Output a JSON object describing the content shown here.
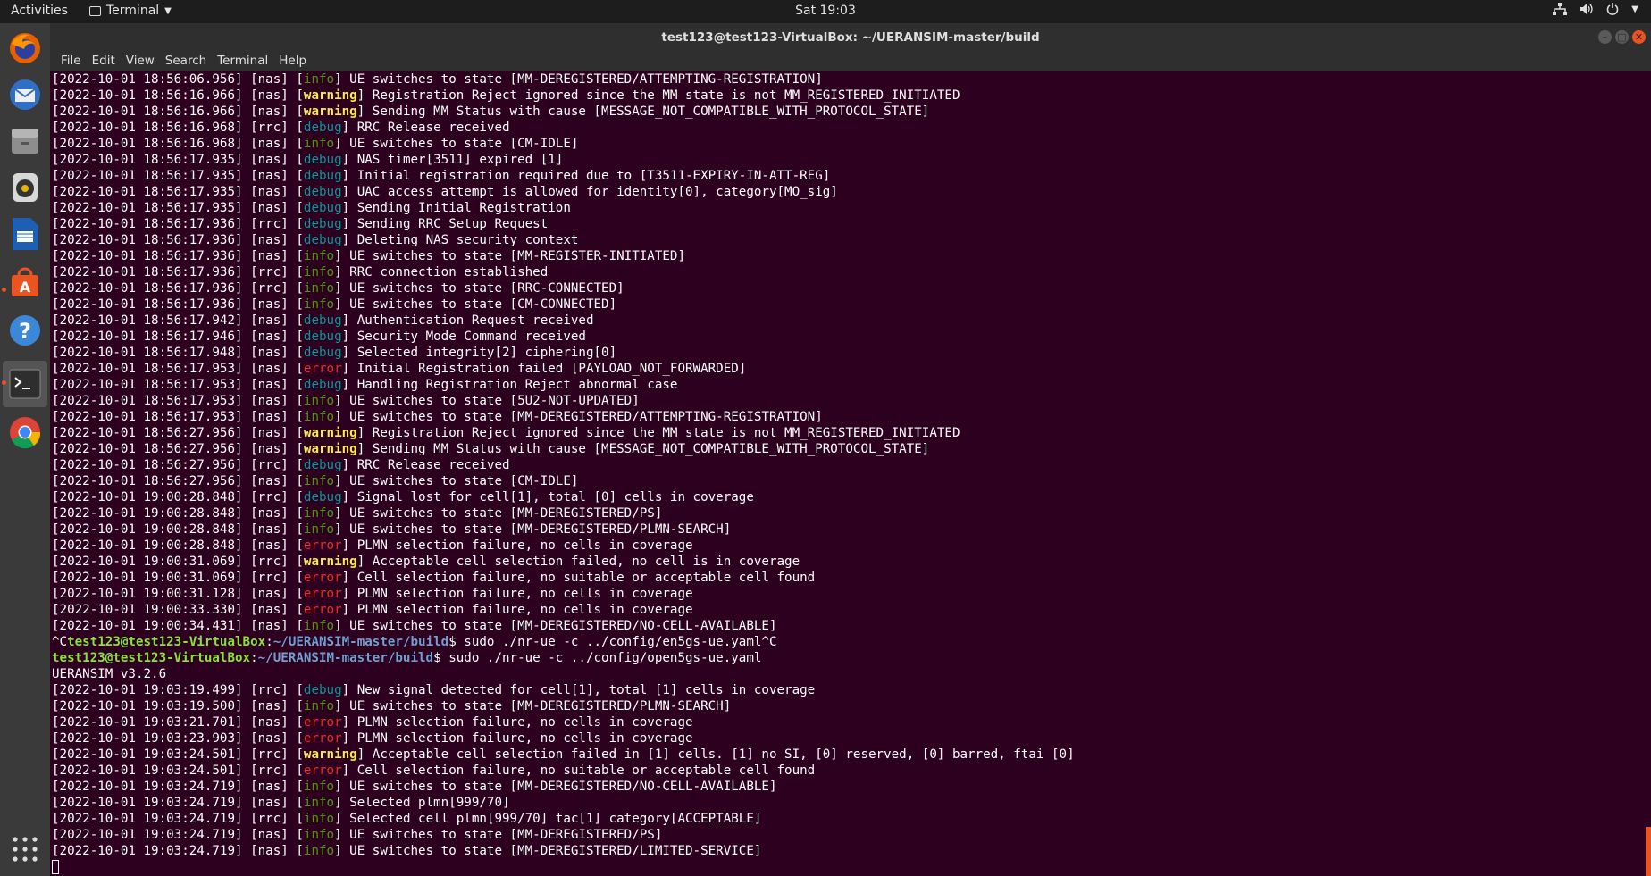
{
  "topbar": {
    "activities": "Activities",
    "app_name": "Terminal",
    "clock": "Sat 19:03"
  },
  "dock": {
    "items": [
      "firefox-icon",
      "thunderbird-icon",
      "files-icon",
      "rhythmbox-icon",
      "writer-icon",
      "software-center-icon",
      "help-icon",
      "terminal-icon",
      "chrome-icon"
    ],
    "apps_grid": "show-applications-icon"
  },
  "window": {
    "title": "test123@test123-VirtualBox: ~/UERANSIM-master/build",
    "menu": [
      "File",
      "Edit",
      "View",
      "Search",
      "Terminal",
      "Help"
    ]
  },
  "colors": {
    "info": "#4e9a06",
    "debug": "#06989a",
    "warning": "#fce94f",
    "error": "#ef2929",
    "background": "#2c001e",
    "accent": "#e95420"
  },
  "terminal": {
    "lines": [
      {
        "t": "log",
        "ts": "[2022-10-01 18:56:06.956]",
        "mod": "[nas]",
        "lvl": "info",
        "msg": " UE switches to state [MM-DEREGISTERED/ATTEMPTING-REGISTRATION]"
      },
      {
        "t": "log",
        "ts": "[2022-10-01 18:56:16.966]",
        "mod": "[nas]",
        "lvl": "warning",
        "msg": " Registration Reject ignored since the MM state is not MM_REGISTERED_INITIATED"
      },
      {
        "t": "log",
        "ts": "[2022-10-01 18:56:16.966]",
        "mod": "[nas]",
        "lvl": "warning",
        "msg": " Sending MM Status with cause [MESSAGE_NOT_COMPATIBLE_WITH_PROTOCOL_STATE]"
      },
      {
        "t": "log",
        "ts": "[2022-10-01 18:56:16.968]",
        "mod": "[rrc]",
        "lvl": "debug",
        "msg": " RRC Release received"
      },
      {
        "t": "log",
        "ts": "[2022-10-01 18:56:16.968]",
        "mod": "[nas]",
        "lvl": "info",
        "msg": " UE switches to state [CM-IDLE]"
      },
      {
        "t": "log",
        "ts": "[2022-10-01 18:56:17.935]",
        "mod": "[nas]",
        "lvl": "debug",
        "msg": " NAS timer[3511] expired [1]"
      },
      {
        "t": "log",
        "ts": "[2022-10-01 18:56:17.935]",
        "mod": "[nas]",
        "lvl": "debug",
        "msg": " Initial registration required due to [T3511-EXPIRY-IN-ATT-REG]"
      },
      {
        "t": "log",
        "ts": "[2022-10-01 18:56:17.935]",
        "mod": "[nas]",
        "lvl": "debug",
        "msg": " UAC access attempt is allowed for identity[0], category[MO_sig]"
      },
      {
        "t": "log",
        "ts": "[2022-10-01 18:56:17.935]",
        "mod": "[nas]",
        "lvl": "debug",
        "msg": " Sending Initial Registration"
      },
      {
        "t": "log",
        "ts": "[2022-10-01 18:56:17.936]",
        "mod": "[rrc]",
        "lvl": "debug",
        "msg": " Sending RRC Setup Request"
      },
      {
        "t": "log",
        "ts": "[2022-10-01 18:56:17.936]",
        "mod": "[nas]",
        "lvl": "debug",
        "msg": " Deleting NAS security context"
      },
      {
        "t": "log",
        "ts": "[2022-10-01 18:56:17.936]",
        "mod": "[nas]",
        "lvl": "info",
        "msg": " UE switches to state [MM-REGISTER-INITIATED]"
      },
      {
        "t": "log",
        "ts": "[2022-10-01 18:56:17.936]",
        "mod": "[rrc]",
        "lvl": "info",
        "msg": " RRC connection established"
      },
      {
        "t": "log",
        "ts": "[2022-10-01 18:56:17.936]",
        "mod": "[rrc]",
        "lvl": "info",
        "msg": " UE switches to state [RRC-CONNECTED]"
      },
      {
        "t": "log",
        "ts": "[2022-10-01 18:56:17.936]",
        "mod": "[nas]",
        "lvl": "info",
        "msg": " UE switches to state [CM-CONNECTED]"
      },
      {
        "t": "log",
        "ts": "[2022-10-01 18:56:17.942]",
        "mod": "[nas]",
        "lvl": "debug",
        "msg": " Authentication Request received"
      },
      {
        "t": "log",
        "ts": "[2022-10-01 18:56:17.946]",
        "mod": "[nas]",
        "lvl": "debug",
        "msg": " Security Mode Command received"
      },
      {
        "t": "log",
        "ts": "[2022-10-01 18:56:17.948]",
        "mod": "[nas]",
        "lvl": "debug",
        "msg": " Selected integrity[2] ciphering[0]"
      },
      {
        "t": "log",
        "ts": "[2022-10-01 18:56:17.953]",
        "mod": "[nas]",
        "lvl": "error",
        "msg": " Initial Registration failed [PAYLOAD_NOT_FORWARDED]"
      },
      {
        "t": "log",
        "ts": "[2022-10-01 18:56:17.953]",
        "mod": "[nas]",
        "lvl": "debug",
        "msg": " Handling Registration Reject abnormal case"
      },
      {
        "t": "log",
        "ts": "[2022-10-01 18:56:17.953]",
        "mod": "[nas]",
        "lvl": "info",
        "msg": " UE switches to state [5U2-NOT-UPDATED]"
      },
      {
        "t": "log",
        "ts": "[2022-10-01 18:56:17.953]",
        "mod": "[nas]",
        "lvl": "info",
        "msg": " UE switches to state [MM-DEREGISTERED/ATTEMPTING-REGISTRATION]"
      },
      {
        "t": "log",
        "ts": "[2022-10-01 18:56:27.956]",
        "mod": "[nas]",
        "lvl": "warning",
        "msg": " Registration Reject ignored since the MM state is not MM_REGISTERED_INITIATED"
      },
      {
        "t": "log",
        "ts": "[2022-10-01 18:56:27.956]",
        "mod": "[nas]",
        "lvl": "warning",
        "msg": " Sending MM Status with cause [MESSAGE_NOT_COMPATIBLE_WITH_PROTOCOL_STATE]"
      },
      {
        "t": "log",
        "ts": "[2022-10-01 18:56:27.956]",
        "mod": "[rrc]",
        "lvl": "debug",
        "msg": " RRC Release received"
      },
      {
        "t": "log",
        "ts": "[2022-10-01 18:56:27.956]",
        "mod": "[nas]",
        "lvl": "info",
        "msg": " UE switches to state [CM-IDLE]"
      },
      {
        "t": "log",
        "ts": "[2022-10-01 19:00:28.848]",
        "mod": "[rrc]",
        "lvl": "debug",
        "msg": " Signal lost for cell[1], total [0] cells in coverage"
      },
      {
        "t": "log",
        "ts": "[2022-10-01 19:00:28.848]",
        "mod": "[nas]",
        "lvl": "info",
        "msg": " UE switches to state [MM-DEREGISTERED/PS]"
      },
      {
        "t": "log",
        "ts": "[2022-10-01 19:00:28.848]",
        "mod": "[nas]",
        "lvl": "info",
        "msg": " UE switches to state [MM-DEREGISTERED/PLMN-SEARCH]"
      },
      {
        "t": "log",
        "ts": "[2022-10-01 19:00:28.848]",
        "mod": "[nas]",
        "lvl": "error",
        "msg": " PLMN selection failure, no cells in coverage"
      },
      {
        "t": "log",
        "ts": "[2022-10-01 19:00:31.069]",
        "mod": "[rrc]",
        "lvl": "warning",
        "msg": " Acceptable cell selection failed, no cell is in coverage"
      },
      {
        "t": "log",
        "ts": "[2022-10-01 19:00:31.069]",
        "mod": "[rrc]",
        "lvl": "error",
        "msg": " Cell selection failure, no suitable or acceptable cell found"
      },
      {
        "t": "log",
        "ts": "[2022-10-01 19:00:31.128]",
        "mod": "[nas]",
        "lvl": "error",
        "msg": " PLMN selection failure, no cells in coverage"
      },
      {
        "t": "log",
        "ts": "[2022-10-01 19:00:33.330]",
        "mod": "[nas]",
        "lvl": "error",
        "msg": " PLMN selection failure, no cells in coverage"
      },
      {
        "t": "log",
        "ts": "[2022-10-01 19:00:34.431]",
        "mod": "[nas]",
        "lvl": "info",
        "msg": " UE switches to state [MM-DEREGISTERED/NO-CELL-AVAILABLE]"
      },
      {
        "t": "prompt",
        "pre": "^C",
        "user": "test123@test123-VirtualBox",
        "path": "~/UERANSIM-master/build",
        "cmd": "$ sudo ./nr-ue -c ../config/en5gs-ue.yaml^C"
      },
      {
        "t": "prompt",
        "pre": "",
        "user": "test123@test123-VirtualBox",
        "path": "~/UERANSIM-master/build",
        "cmd": "$ sudo ./nr-ue -c ../config/open5gs-ue.yaml"
      },
      {
        "t": "plain",
        "text": "UERANSIM v3.2.6"
      },
      {
        "t": "log",
        "ts": "[2022-10-01 19:03:19.499]",
        "mod": "[rrc]",
        "lvl": "debug",
        "msg": " New signal detected for cell[1], total [1] cells in coverage"
      },
      {
        "t": "log",
        "ts": "[2022-10-01 19:03:19.500]",
        "mod": "[nas]",
        "lvl": "info",
        "msg": " UE switches to state [MM-DEREGISTERED/PLMN-SEARCH]"
      },
      {
        "t": "log",
        "ts": "[2022-10-01 19:03:21.701]",
        "mod": "[nas]",
        "lvl": "error",
        "msg": " PLMN selection failure, no cells in coverage"
      },
      {
        "t": "log",
        "ts": "[2022-10-01 19:03:23.903]",
        "mod": "[nas]",
        "lvl": "error",
        "msg": " PLMN selection failure, no cells in coverage"
      },
      {
        "t": "log",
        "ts": "[2022-10-01 19:03:24.501]",
        "mod": "[rrc]",
        "lvl": "warning",
        "msg": " Acceptable cell selection failed in [1] cells. [1] no SI, [0] reserved, [0] barred, ftai [0]"
      },
      {
        "t": "log",
        "ts": "[2022-10-01 19:03:24.501]",
        "mod": "[rrc]",
        "lvl": "error",
        "msg": " Cell selection failure, no suitable or acceptable cell found"
      },
      {
        "t": "log",
        "ts": "[2022-10-01 19:03:24.719]",
        "mod": "[nas]",
        "lvl": "info",
        "msg": " UE switches to state [MM-DEREGISTERED/NO-CELL-AVAILABLE]"
      },
      {
        "t": "log",
        "ts": "[2022-10-01 19:03:24.719]",
        "mod": "[nas]",
        "lvl": "info",
        "msg": " Selected plmn[999/70]"
      },
      {
        "t": "log",
        "ts": "[2022-10-01 19:03:24.719]",
        "mod": "[rrc]",
        "lvl": "info",
        "msg": " Selected cell plmn[999/70] tac[1] category[ACCEPTABLE]"
      },
      {
        "t": "log",
        "ts": "[2022-10-01 19:03:24.719]",
        "mod": "[nas]",
        "lvl": "info",
        "msg": " UE switches to state [MM-DEREGISTERED/PS]"
      },
      {
        "t": "log",
        "ts": "[2022-10-01 19:03:24.719]",
        "mod": "[nas]",
        "lvl": "info",
        "msg": " UE switches to state [MM-DEREGISTERED/LIMITED-SERVICE]"
      },
      {
        "t": "cursor"
      }
    ]
  }
}
